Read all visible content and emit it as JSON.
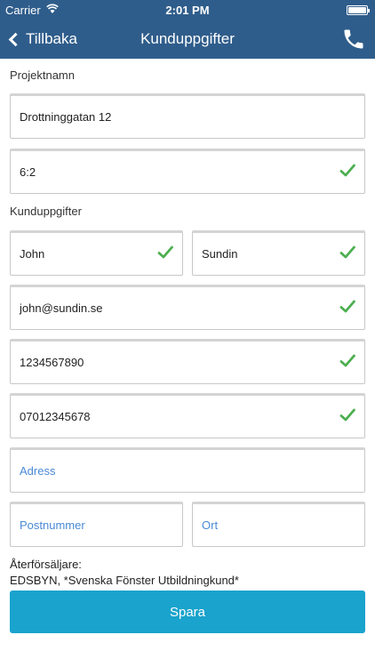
{
  "status_bar": {
    "carrier": "Carrier",
    "time": "2:01 PM",
    "wifi_icon": "wifi-icon",
    "battery_icon": "battery-icon"
  },
  "nav": {
    "back_label": "Tillbaka",
    "title": "Kunduppgifter",
    "phone_icon": "phone-icon",
    "back_icon": "chevron-left-icon",
    "background_color": "#2f5d8b"
  },
  "project": {
    "section_label": "Projektnamn",
    "name_value": "Drottninggatan 12",
    "number_value": "6:2",
    "number_valid": true
  },
  "customer": {
    "section_label": "Kunduppgifter",
    "first_name": "John",
    "last_name": "Sundin",
    "email": "john@sundin.se",
    "phone": "1234567890",
    "mobile": "07012345678",
    "address_placeholder": "Adress",
    "postal_placeholder": "Postnummer",
    "city_placeholder": "Ort",
    "check_color": "#4caf50"
  },
  "dealer": {
    "label": "Återförsäljare:",
    "value": "EDSBYN, *Svenska Fönster Utbildningkund*"
  },
  "actions": {
    "save_label": "Spara",
    "save_color": "#1aa3cc"
  }
}
